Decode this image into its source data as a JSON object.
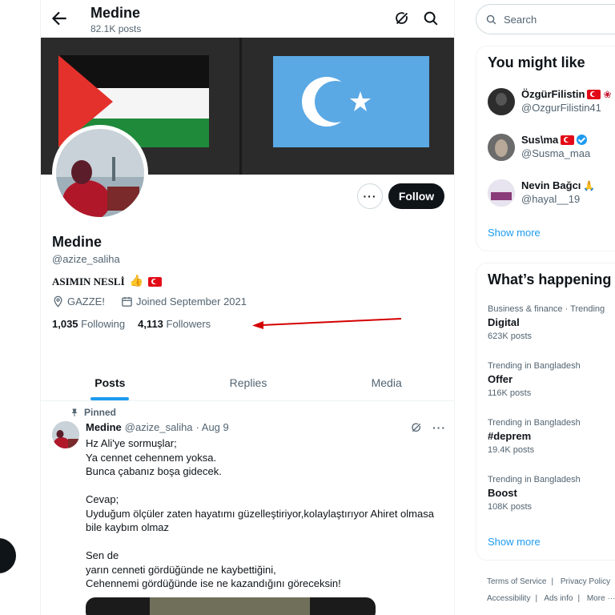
{
  "header": {
    "name": "Medine",
    "posts_count": "82.1K posts"
  },
  "profile": {
    "name": "Medine",
    "handle": "@azize_saliha",
    "bio": "ASIMIN NESLİ",
    "location": "GAZZE!",
    "joined": "Joined September 2021",
    "following_count": "1,035",
    "following_label": "Following",
    "followers_count": "4,113",
    "followers_label": "Followers",
    "follow_label": "Follow"
  },
  "tabs": [
    {
      "label": "Posts",
      "active": true
    },
    {
      "label": "Replies",
      "active": false
    },
    {
      "label": "Media",
      "active": false
    }
  ],
  "post": {
    "pinned_label": "Pinned",
    "author": "Medine",
    "handle": "@azize_saliha",
    "date": "· Aug 9",
    "lines": [
      "Hz Ali'ye sormuşlar;",
      "Ya cennet cehennem yoksa.",
      "Bunca çabanız boşa gidecek.",
      "Cevap;",
      "Uyduğum ölçüler zaten hayatımı güzelleştiriyor,kolaylaştırıyor Ahiret olmasa bile kaybım olmaz",
      "Sen de",
      "yarın cenneti gördüğünde ne kaybettiğini,",
      "Cehennemi gördüğünde ise ne kazandığını göreceksin!"
    ]
  },
  "search": {
    "placeholder": "Search"
  },
  "you_might_like": {
    "title": "You might like",
    "users": [
      {
        "name": "ÖzgürFilistin",
        "handle": "@OzgurFilistin41"
      },
      {
        "name": "Sus\\ma",
        "handle": "@Susma_maa"
      },
      {
        "name": "Nevin Bağcı",
        "handle": "@hayal__19"
      }
    ],
    "show_more": "Show more"
  },
  "happening": {
    "title": "What’s happening",
    "trends": [
      {
        "context": "Business & finance · Trending",
        "name": "Digital",
        "count": "623K posts"
      },
      {
        "context": "Trending in Bangladesh",
        "name": "Offer",
        "count": "116K posts"
      },
      {
        "context": "Trending in Bangladesh",
        "name": "#deprem",
        "count": "19.4K posts"
      },
      {
        "context": "Trending in Bangladesh",
        "name": "Boost",
        "count": "108K posts"
      }
    ],
    "show_more": "Show more"
  },
  "footer": {
    "links": [
      "Terms of Service",
      "Privacy Policy",
      "|",
      "Accessibility",
      "Ads info",
      "More ···"
    ]
  },
  "colors": {
    "accent": "#1d9bf0",
    "text": "#0f1419",
    "muted": "#536471",
    "annotation": "#d40000"
  }
}
